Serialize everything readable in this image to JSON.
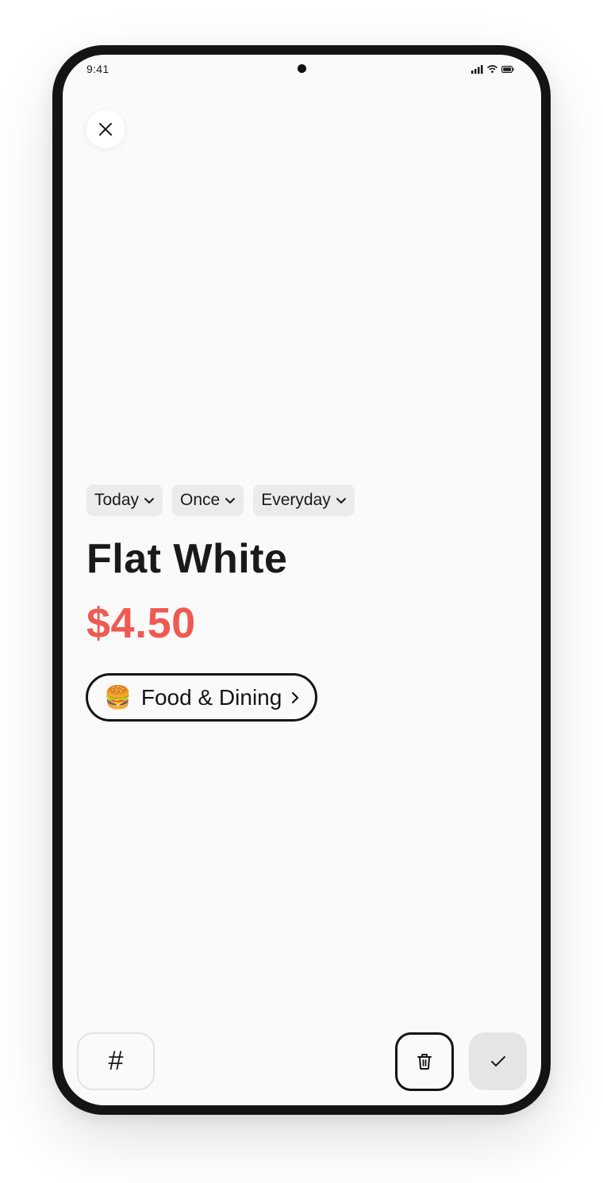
{
  "status_bar": {
    "time": "9:41",
    "icons": [
      "signal-icon",
      "wifi-icon",
      "battery-icon"
    ]
  },
  "header": {
    "close_icon": "close-icon"
  },
  "chips": [
    {
      "label": "Today",
      "icon": "chevron-down-icon"
    },
    {
      "label": "Once",
      "icon": "chevron-down-icon"
    },
    {
      "label": "Everyday",
      "icon": "chevron-down-icon"
    }
  ],
  "transaction": {
    "title": "Flat White",
    "amount": "$4.50",
    "amount_color": "#ee5a52"
  },
  "category": {
    "emoji": "🍔",
    "label": "Food & Dining",
    "icon": "chevron-right-icon"
  },
  "bottom_bar": {
    "tag_label": "#",
    "delete_icon": "trash-icon",
    "confirm_icon": "check-icon"
  }
}
